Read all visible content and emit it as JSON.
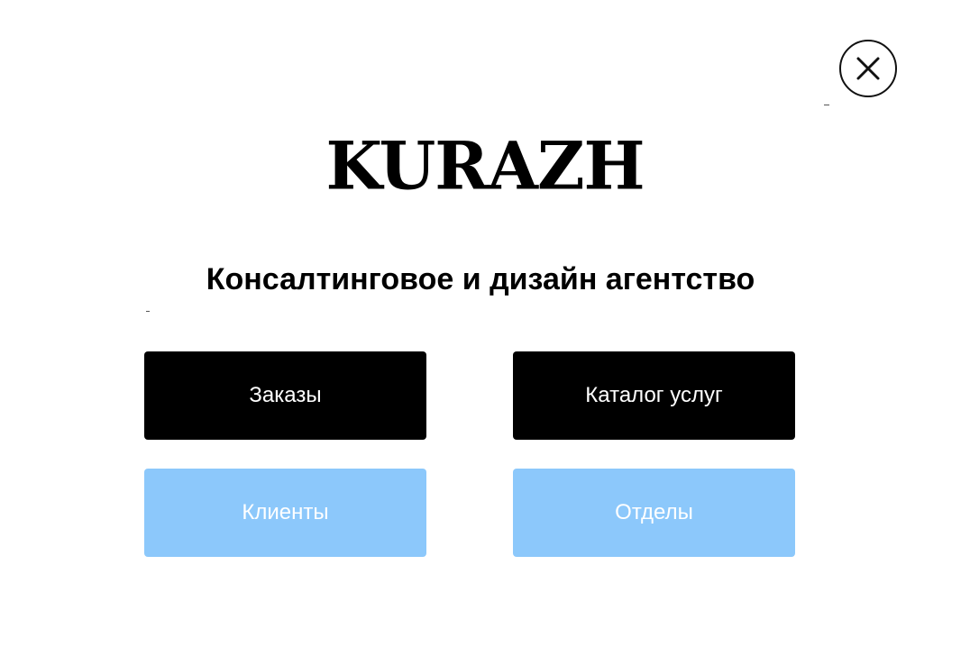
{
  "brand": {
    "logo_text": "KURAZH",
    "subtitle": "Консалтинговое и дизайн агентство"
  },
  "actions": {
    "orders_label": "Заказы",
    "catalog_label": "Каталог услуг",
    "clients_label": "Клиенты",
    "departments_label": "Отделы"
  },
  "icons": {
    "close": "close-icon"
  },
  "colors": {
    "dark_tile": "#000000",
    "light_tile": "#8cc8fb",
    "text_on_tile": "#ffffff",
    "background": "#ffffff"
  }
}
